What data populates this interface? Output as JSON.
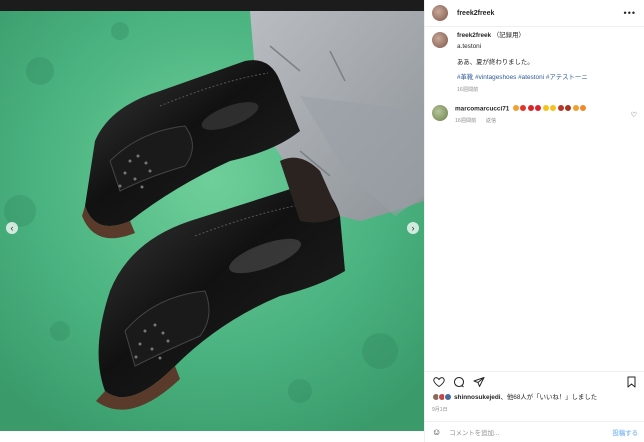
{
  "post": {
    "username": "freek2freek",
    "caption_username": "freek2freek",
    "caption_note": "（記録用）",
    "caption_lines": [
      "a.testoni",
      "ああ、夏が終わりました。"
    ],
    "hashtags": "#革靴 #vintageshoes #atestoni #アテストーニ",
    "caption_time": "16週間前"
  },
  "comment": {
    "username": "marcomarcucci71",
    "time": "16週間前",
    "reply_label": "返信",
    "emojis": [
      "#f2a12e",
      "#e4332c",
      "#d6262b",
      "#e0202e",
      "#f5c21c",
      "#f5c21c",
      "#b7382b",
      "#a8331f",
      "#f0a030",
      "#f08a28"
    ]
  },
  "likes": {
    "lead_user": "shinnosukejedi",
    "text": "、他68人が「いいね！」しました"
  },
  "date": "9月1日",
  "add_comment": {
    "placeholder": "コメントを追加...",
    "post_label": "投稿する"
  },
  "icons": {
    "more": "more-options-icon",
    "heart": "heart-icon",
    "comment": "comment-icon",
    "share": "share-icon",
    "bookmark": "bookmark-icon",
    "emoji": "emoji-icon"
  },
  "colors": {
    "hashtag": "#2e5b9a",
    "post_button": "#93c3f3",
    "background_green": "#3fae78"
  }
}
